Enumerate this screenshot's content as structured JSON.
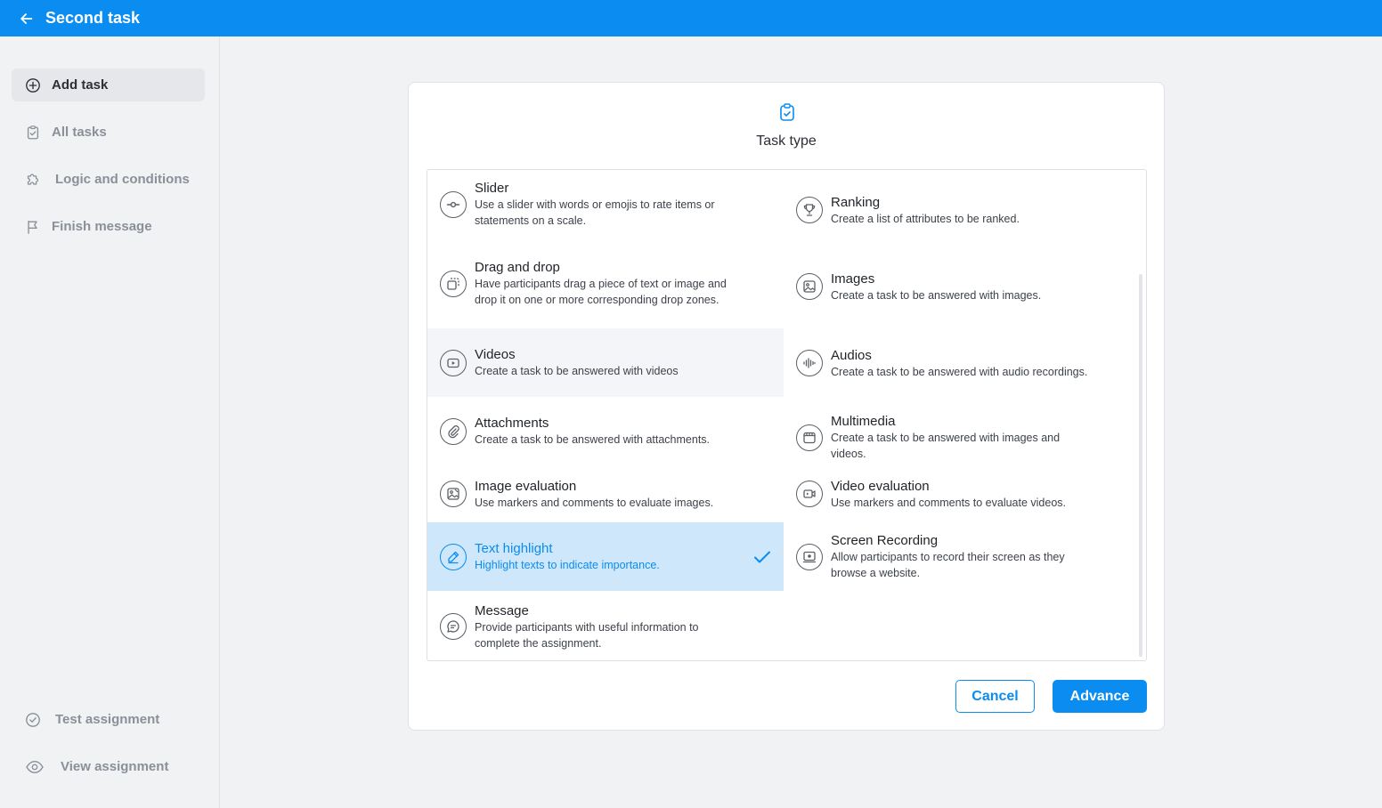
{
  "header": {
    "title": "Second task",
    "back_icon": "arrow-left-icon"
  },
  "sidebar": {
    "items": [
      {
        "label": "Add task",
        "icon": "plus-circle-icon",
        "active": true
      },
      {
        "label": "All tasks",
        "icon": "clipboard-check-icon"
      },
      {
        "label": "Logic and conditions",
        "icon": "puzzle-icon"
      },
      {
        "label": "Finish message",
        "icon": "flag-icon"
      }
    ],
    "bottom_items": [
      {
        "label": "Test assignment",
        "icon": "check-circle-icon"
      },
      {
        "label": "View assignment",
        "icon": "eye-icon"
      }
    ]
  },
  "modal": {
    "title": "Task type",
    "icon": "clipboard-check-icon",
    "task_types": [
      {
        "name": "Slider",
        "desc": "Use a slider with words or emojis to rate items or statements on a scale.",
        "icon": "slider-icon"
      },
      {
        "name": "Ranking",
        "desc": "Create a list of attributes to be ranked.",
        "icon": "trophy-icon"
      },
      {
        "name": "Drag and drop",
        "desc": "Have participants drag a piece of text or image and drop it on one or more corresponding drop zones.",
        "icon": "drag-drop-icon"
      },
      {
        "name": "Images",
        "desc": "Create a task to be answered with images.",
        "icon": "image-icon"
      },
      {
        "name": "Videos",
        "desc": "Create a task to be answered with videos",
        "icon": "video-play-icon"
      },
      {
        "name": "Audios",
        "desc": "Create a task to be answered with audio recordings.",
        "icon": "audio-wave-icon"
      },
      {
        "name": "Attachments",
        "desc": "Create a task to be answered with attachments.",
        "icon": "paperclip-icon"
      },
      {
        "name": "Multimedia",
        "desc": "Create a task to be answered with images and videos.",
        "icon": "multimedia-icon"
      },
      {
        "name": "Image evaluation",
        "desc": "Use markers and comments to evaluate images.",
        "icon": "image-eval-icon"
      },
      {
        "name": "Video evaluation",
        "desc": "Use markers and comments to evaluate videos.",
        "icon": "video-eval-icon"
      },
      {
        "name": "Text highlight",
        "desc": "Highlight texts to indicate importance.",
        "icon": "highlighter-icon",
        "selected": true
      },
      {
        "name": "Screen Recording",
        "desc": "Allow participants to record their screen as they browse a website.",
        "icon": "screen-record-icon"
      },
      {
        "name": "Message",
        "desc": "Provide participants with useful information to complete the assignment.",
        "icon": "message-icon"
      }
    ],
    "cancel_label": "Cancel",
    "advance_label": "Advance"
  },
  "colors": {
    "primary": "#0a8cf0",
    "selected_bg": "#cfe7fb",
    "hover_bg": "#f4f5f8"
  }
}
